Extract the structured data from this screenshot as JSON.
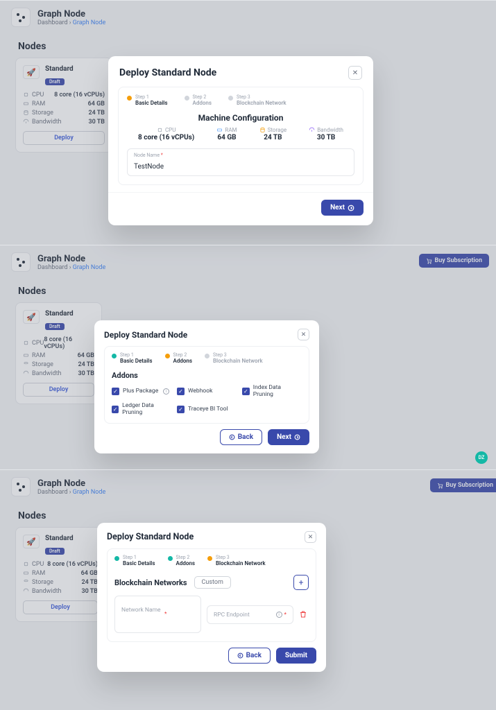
{
  "header": {
    "title": "Graph Node",
    "crumb_home": "Dashboard",
    "crumb_sep": "›",
    "crumb_current": "Graph Node"
  },
  "buy_subscription": "Buy Subscription",
  "green_badge": "DZ",
  "section_title": "Nodes",
  "node_card": {
    "title": "Standard",
    "badge": "Draft",
    "specs": {
      "cpu_label": "CPU",
      "cpu_val": "8 core (16 vCPUs)",
      "ram_label": "RAM",
      "ram_val": "64 GB",
      "storage_label": "Storage",
      "storage_val": "24 TB",
      "bandwidth_label": "Bandwidth",
      "bandwidth_val": "30 TB"
    },
    "deploy": "Deploy"
  },
  "modal": {
    "title": "Deploy Standard Node",
    "steps": {
      "s1_num": "Step 1",
      "s1_name": "Basic Details",
      "s2_num": "Step 2",
      "s2_name": "Addons",
      "s3_num": "Step 3",
      "s3_name": "Blockchain Network"
    },
    "machine_title": "Machine Configuration",
    "machine": {
      "cpu_label": "CPU",
      "cpu_val": "8 core (16 vCPUs)",
      "ram_label": "RAM",
      "ram_val": "64 GB",
      "storage_label": "Storage",
      "storage_val": "24 TB",
      "bandwidth_label": "Bandwidth",
      "bandwidth_val": "30 TB"
    },
    "node_name_label": "Node Name",
    "node_name_value": "TestNode",
    "next": "Next",
    "back": "Back",
    "submit": "Submit"
  },
  "addons": {
    "title": "Addons",
    "items": {
      "a0": "Plus Package",
      "a1": "Webhook",
      "a2": "Index Data Pruning",
      "a3": "Ledger Data Pruning",
      "a4": "Traceye BI Tool"
    }
  },
  "blockchain": {
    "title": "Blockchain Networks",
    "custom": "Custom",
    "net_name_ph": "Network Name",
    "rpc_ph": "RPC Endpoint"
  }
}
